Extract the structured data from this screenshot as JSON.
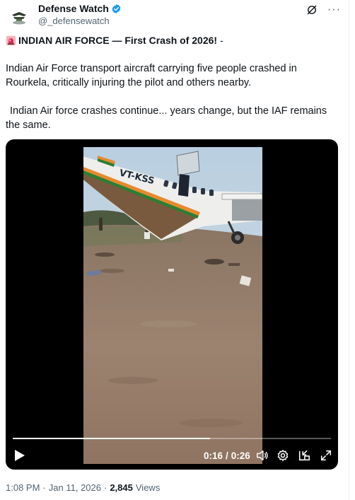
{
  "author": {
    "display_name": "Defense Watch",
    "handle": "@_defensewatch",
    "verified_color": "#1d9bf0"
  },
  "header_icons": [
    "grok-icon",
    "more-icon"
  ],
  "more_label": "···",
  "post": {
    "headline": "INDIAN AIR FORCE — First Crash of 2026!",
    "headline_suffix": "-",
    "paragraph1": "Indian Air Force transport aircraft carrying five people crashed in Rourkela, critically injuring the pilot and others nearby.",
    "paragraph2": "Indian Air force crashes continue... years change, but the IAF remains the same."
  },
  "video": {
    "current_time": "0:16",
    "separator": "/",
    "duration": "0:26",
    "progress_fraction": 0.62,
    "aircraft_registration": "VT-KSS"
  },
  "footer": {
    "time": "1:08 PM",
    "dot": "·",
    "date": "Jan 11, 2026",
    "dot2": "·",
    "views_count": "2,845",
    "views_label": "Views"
  },
  "colors": {
    "text": "#0f1419",
    "secondary": "#536471",
    "accent": "#1d9bf0"
  }
}
